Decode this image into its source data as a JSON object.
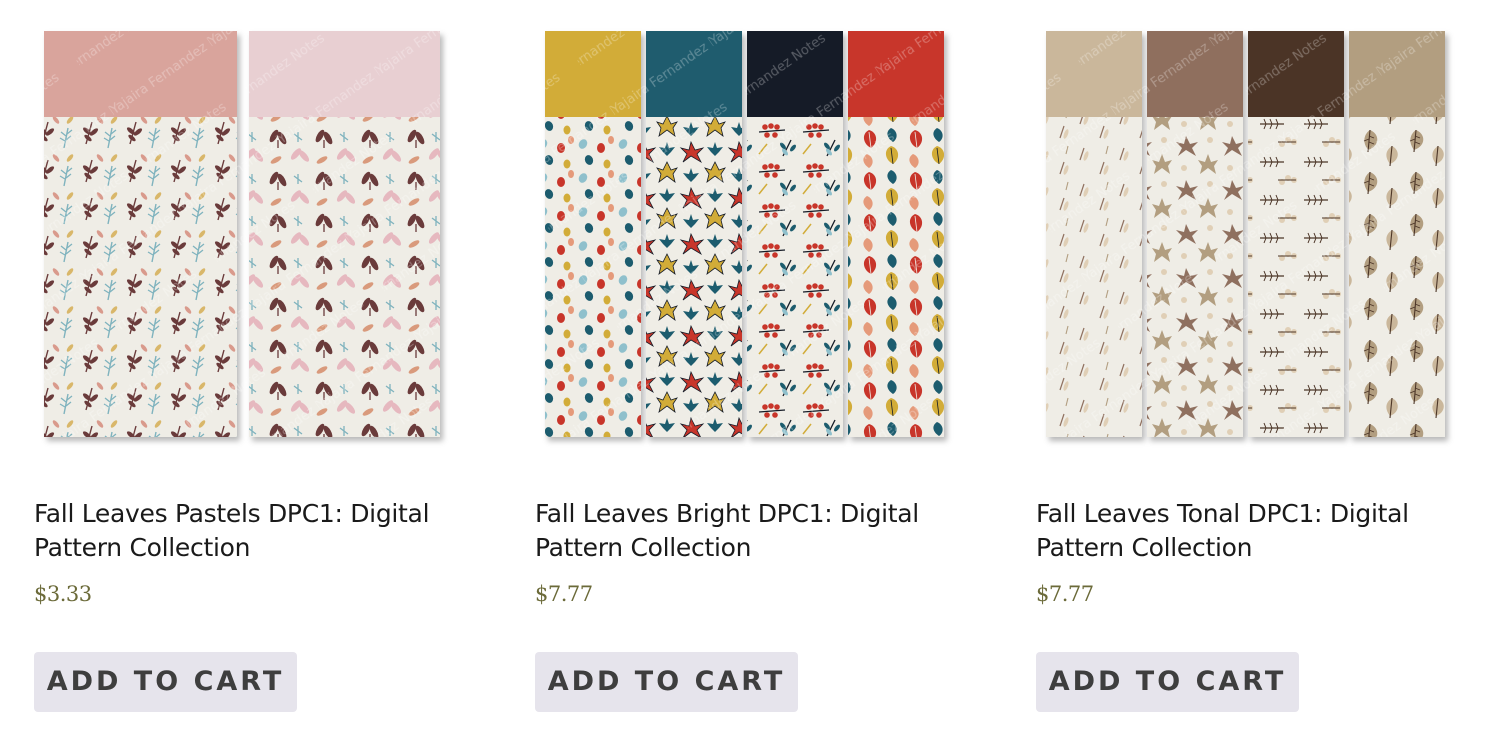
{
  "products": [
    {
      "title": "Fall Leaves Pastels DPC1: Digital Pattern Collection",
      "price": "$3.33",
      "add_to_cart": "ADD TO CART",
      "watermark": "Yajaira Fernandez Notes",
      "swatches": [
        "#d9a49c",
        "#e8cfd2"
      ]
    },
    {
      "title": "Fall Leaves Bright DPC1: Digital Pattern Collection",
      "price": "$7.77",
      "add_to_cart": "ADD TO CART",
      "watermark": "Yajaira Fernandez Notes",
      "swatches": [
        "#d2ac38",
        "#1f5c6e",
        "#151b27",
        "#c8362b"
      ]
    },
    {
      "title": "Fall Leaves Tonal DPC1: Digital Pattern Collection",
      "price": "$7.77",
      "add_to_cart": "ADD TO CART",
      "watermark": "Yajaira Fernandez Notes",
      "swatches": [
        "#cab79b",
        "#8f6f5e",
        "#4b3426",
        "#b29e80"
      ]
    }
  ],
  "colors": {
    "price": "#6b6a39",
    "button_bg": "#e6e4ec",
    "button_text": "#3e3e3e",
    "paper": "#efede6"
  }
}
